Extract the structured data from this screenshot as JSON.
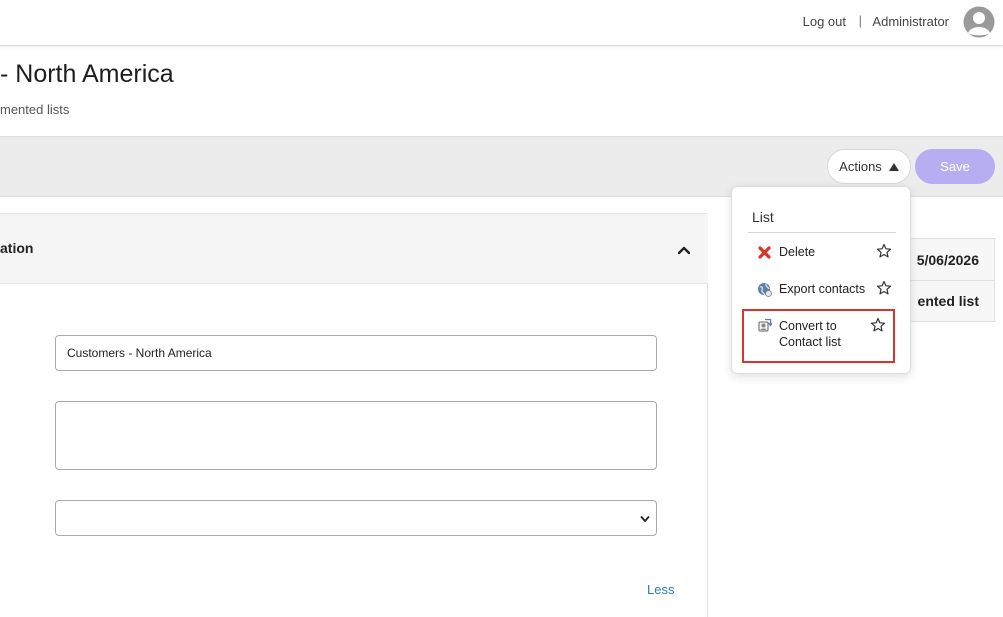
{
  "header": {
    "logout_label": "Log out",
    "separator": "|",
    "user_name": "Administrator",
    "avatar_icon": "user-avatar-icon"
  },
  "page": {
    "title": "- North America",
    "subtitle": "mented lists"
  },
  "toolbar": {
    "actions_label": "Actions",
    "save_label": "Save",
    "save_color": "#b7aef1"
  },
  "panel": {
    "title": "ation",
    "name_value": "Customers - North America",
    "description_value": "",
    "select_value": "",
    "less_label": "Less"
  },
  "info_card": {
    "date": "5/06/2026",
    "type": "ented list"
  },
  "actions_menu": {
    "header": "List",
    "items": [
      {
        "label": "Delete",
        "icon": "delete-x-icon",
        "favorite_icon": "star-outline-icon"
      },
      {
        "label": "Export contacts",
        "icon": "globe-export-icon",
        "favorite_icon": "star-outline-icon"
      },
      {
        "label": "Convert to Contact list",
        "icon": "convert-list-icon",
        "favorite_icon": "star-outline-icon"
      }
    ],
    "highlight_color": "#d9342b"
  }
}
